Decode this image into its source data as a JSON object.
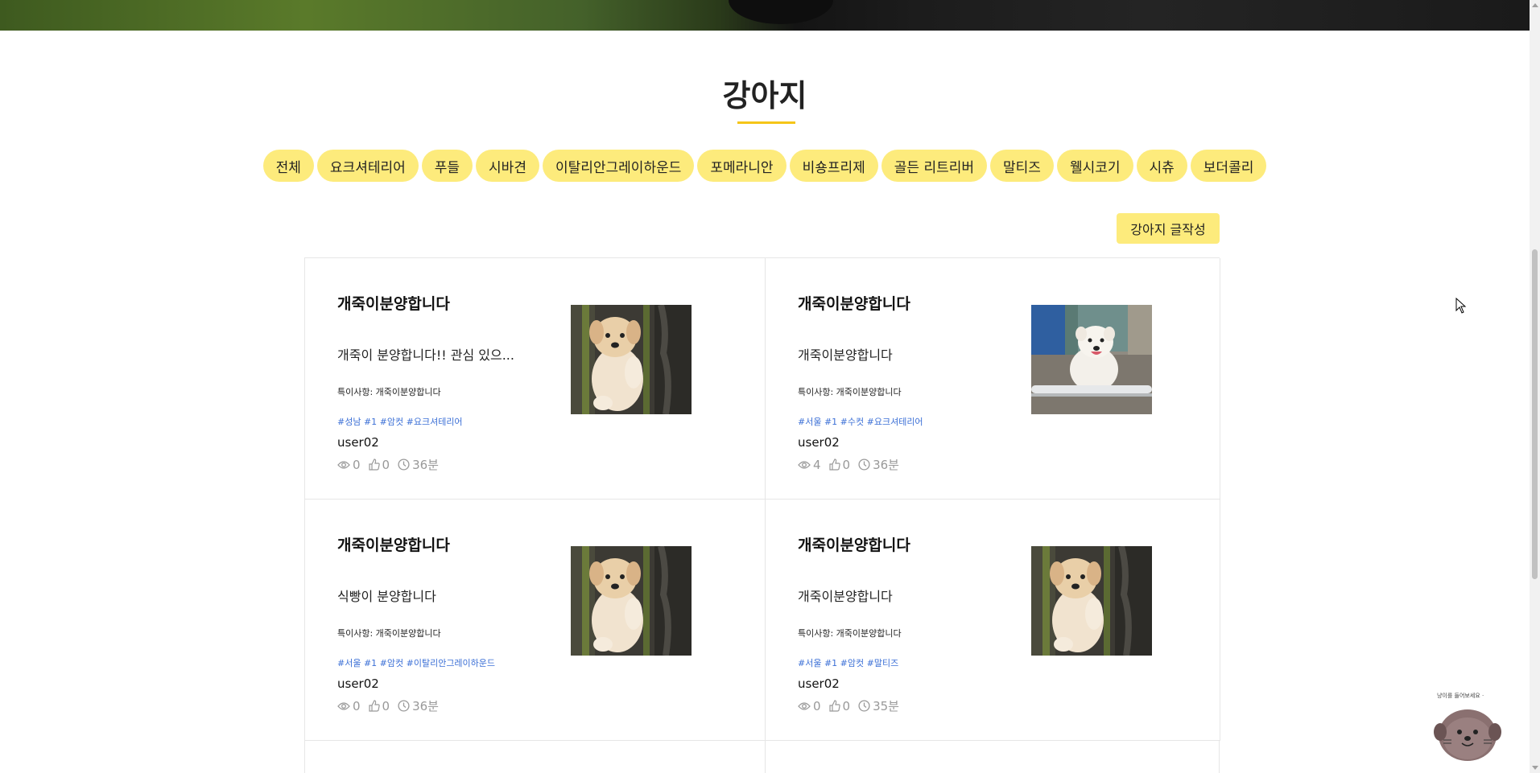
{
  "page": {
    "title": "강아지"
  },
  "breeds": [
    "전체",
    "요크셔테리어",
    "푸들",
    "시바견",
    "이탈리안그레이하운드",
    "포메라니안",
    "비숑프리제",
    "골든 리트리버",
    "말티즈",
    "웰시코기",
    "시츄",
    "보더콜리"
  ],
  "write_button": "강아지 글작성",
  "posts": [
    {
      "title": "개죽이분양합니다",
      "desc": "개죽이 분양합니다!! 관심 있으...",
      "note": "특이사항: 개죽이분양합니다",
      "tags": "#성남 #1 #암컷 #요크셔테리어",
      "author": "user02",
      "views": "0",
      "likes": "0",
      "time": "36분",
      "image": "puppy-bamboo"
    },
    {
      "title": "개죽이분양합니다",
      "desc": "개죽이분양합니다",
      "note": "특이사항: 개죽이분양합니다",
      "tags": "#서울 #1 #수컷 #요크셔테리어",
      "author": "user02",
      "views": "4",
      "likes": "0",
      "time": "36분",
      "image": "white-dog-fence"
    },
    {
      "title": "개죽이분양합니다",
      "desc": "식빵이 분양합니다",
      "note": "특이사항: 개죽이분양합니다",
      "tags": "#서울 #1 #암컷 #이탈리안그레이하운드",
      "author": "user02",
      "views": "0",
      "likes": "0",
      "time": "36분",
      "image": "puppy-bamboo"
    },
    {
      "title": "개죽이분양합니다",
      "desc": "개죽이분양합니다",
      "note": "특이사항: 개죽이분양합니다",
      "tags": "#서울 #1 #암컷 #말티즈",
      "author": "user02",
      "views": "0",
      "likes": "0",
      "time": "35분",
      "image": "puppy-bamboo"
    }
  ],
  "mascot_text": "냥이를 들어보세요 ·",
  "colors": {
    "accent": "#fdeb7c",
    "underline": "#f5c518",
    "tag": "#3b6fd6"
  }
}
